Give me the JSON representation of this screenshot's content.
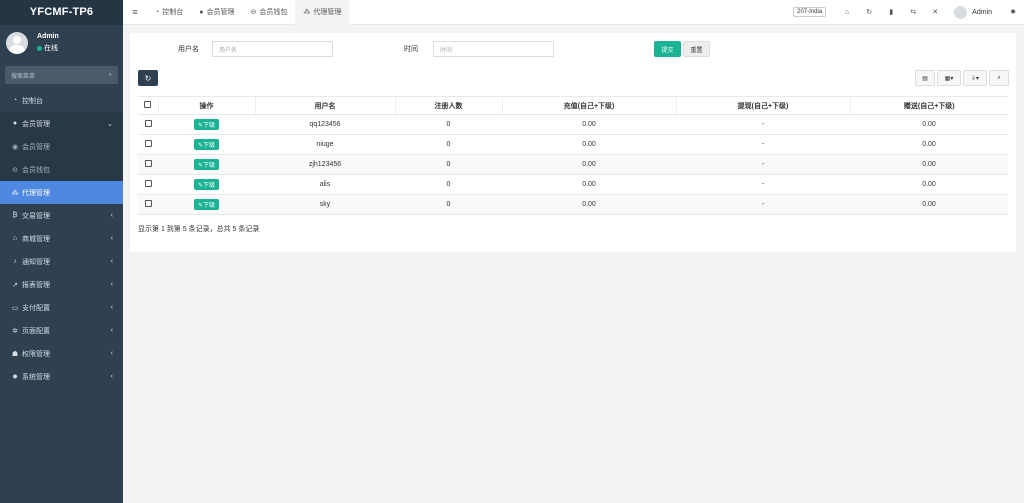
{
  "app": {
    "brand": "YFCMF-TP6",
    "user_name": "Admin",
    "user_status": "在线",
    "search_placeholder": "搜索菜单"
  },
  "sidebar": {
    "items": [
      {
        "label": "控制台",
        "icon": "dashboard-icon"
      },
      {
        "label": "会员管理",
        "icon": "user-icon",
        "arrow": "⌄"
      },
      {
        "label": "会员管理",
        "icon": "user-list-icon",
        "sub": true
      },
      {
        "label": "会员钱包",
        "icon": "wallet-icon",
        "sub": true
      },
      {
        "label": "代理管理",
        "icon": "sitemap-icon",
        "active": true
      },
      {
        "label": "交易管理",
        "icon": "bitcoin-icon",
        "arrow": "‹"
      },
      {
        "label": "商城管理",
        "icon": "home-icon",
        "arrow": "‹"
      },
      {
        "label": "通知管理",
        "icon": "bell-icon",
        "arrow": "‹"
      },
      {
        "label": "报表管理",
        "icon": "chart-icon",
        "arrow": "‹"
      },
      {
        "label": "支付配置",
        "icon": "card-icon",
        "arrow": "‹"
      },
      {
        "label": "页面配置",
        "icon": "gear-icon",
        "arrow": "‹"
      },
      {
        "label": "权限管理",
        "icon": "users-icon",
        "arrow": "‹"
      },
      {
        "label": "系统管理",
        "icon": "gears-icon",
        "arrow": "‹"
      }
    ]
  },
  "topbar": {
    "tabs": [
      "控制台",
      "会员管理",
      "会员钱包",
      "代理管理"
    ],
    "country": "207-India",
    "admin": "Admin"
  },
  "form": {
    "username_label": "用户名",
    "username_placeholder": "用户名",
    "time_label": "时间",
    "time_placeholder": "时间",
    "submit": "提交",
    "reset": "重置"
  },
  "table": {
    "headers": [
      "操作",
      "用户名",
      "注册人数",
      "充值(自己+下级)",
      "提现(自己+下级)",
      "赠送(自己+下级)"
    ],
    "action_label": "下级",
    "rows": [
      {
        "username": "qq123456",
        "reg": "0",
        "recharge": "0.00",
        "withdraw": "-",
        "gift": "0.00"
      },
      {
        "username": "niuge",
        "reg": "0",
        "recharge": "0.00",
        "withdraw": "-",
        "gift": "0.00"
      },
      {
        "username": "zjh123456",
        "reg": "0",
        "recharge": "0.00",
        "withdraw": "-",
        "gift": "0.00"
      },
      {
        "username": "alis",
        "reg": "0",
        "recharge": "0.00",
        "withdraw": "-",
        "gift": "0.00"
      },
      {
        "username": "sky",
        "reg": "0",
        "recharge": "0.00",
        "withdraw": "-",
        "gift": "0.00"
      }
    ],
    "summary": "显示第 1 到第 5 条记录，总共 5 条记录"
  },
  "colors": {
    "sidebar_bg": "#2f4050",
    "active": "#4f88e0",
    "accent": "#1ab394"
  }
}
